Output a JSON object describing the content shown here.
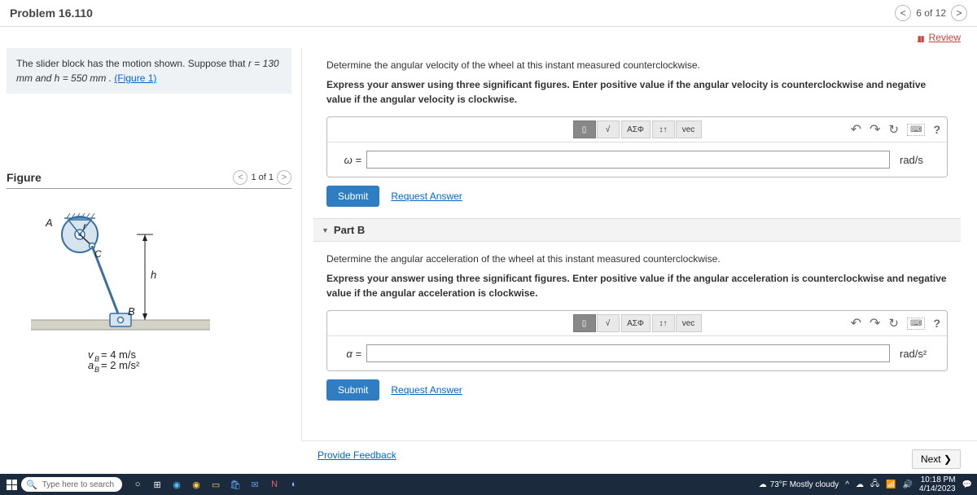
{
  "header": {
    "problem": "Problem 16.110",
    "counter": "6 of 12",
    "review": "Review"
  },
  "sidebar": {
    "info_prefix": "The slider block has the motion shown. Suppose that ",
    "info_vars": "r = 130  mm and h = 550  mm . ",
    "figure_link": "(Figure 1)",
    "figure_title": "Figure",
    "figure_counter": "1 of 1",
    "fig_labels": {
      "A": "A",
      "r": "r",
      "C": "C",
      "h": "h",
      "B": "B",
      "vb": "v_B = 4 m/s",
      "ab": "a_B = 2 m/s²"
    }
  },
  "partA": {
    "q1": "Determine the angular velocity of the wheel at this instant measured counterclockwise.",
    "q2": "Express your answer using three significant figures. Enter positive value if the angular velocity is counterclockwise and negative value if the angular velocity is clockwise.",
    "label": "ω =",
    "unit": "rad/s",
    "submit": "Submit",
    "req": "Request Answer"
  },
  "partB": {
    "title": "Part B",
    "q1": "Determine the angular acceleration of the wheel at this instant measured counterclockwise.",
    "q2": "Express your answer using three significant figures. Enter positive value if the angular acceleration is counterclockwise and negative value if the angular acceleration is clockwise.",
    "label": "α =",
    "unit": "rad/s²",
    "submit": "Submit",
    "req": "Request Answer"
  },
  "toolbar": {
    "sqrt": "√",
    "frac": "▯",
    "asph": "ΑΣΦ",
    "arrows": "↕↑",
    "vec": "vec",
    "help": "?"
  },
  "footer": {
    "feedback": "Provide Feedback",
    "next": "Next ❯"
  },
  "taskbar": {
    "search": "Type here to search",
    "weather": "73°F Mostly cloudy",
    "time": "10:18 PM",
    "date": "4/14/2023"
  }
}
